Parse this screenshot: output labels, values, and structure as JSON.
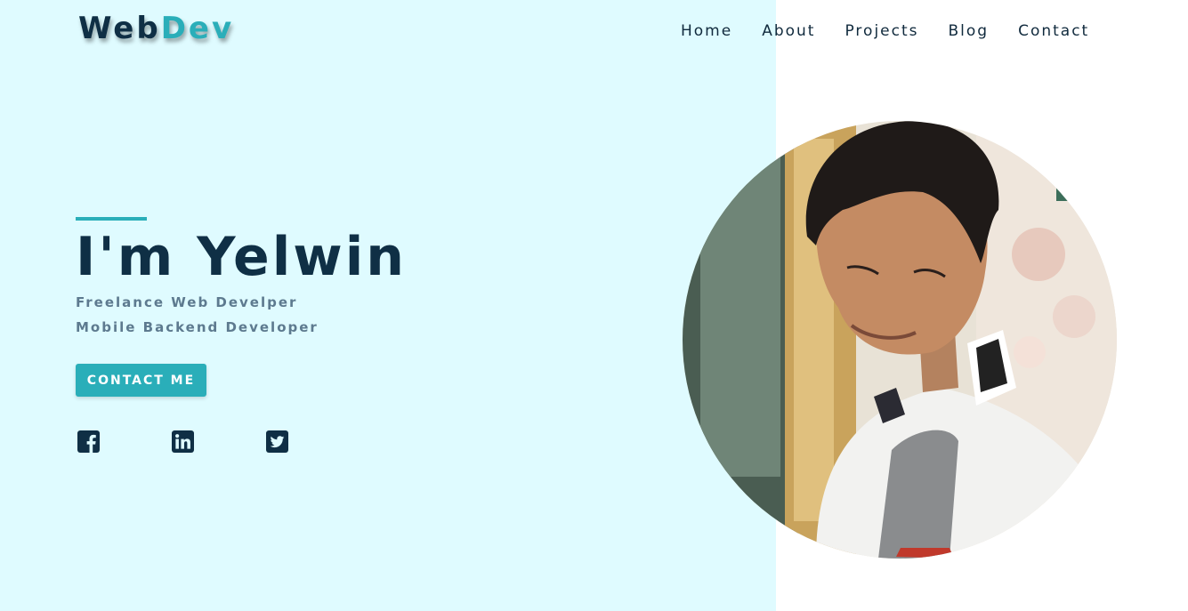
{
  "logo": {
    "part1": "Web",
    "part2": "Dev"
  },
  "nav": {
    "items": [
      {
        "label": "Home"
      },
      {
        "label": "About"
      },
      {
        "label": "Projects"
      },
      {
        "label": "Blog"
      },
      {
        "label": "Contact"
      }
    ]
  },
  "hero": {
    "title": "I'm Yelwin",
    "subtitle_1": "Freelance Web Develper",
    "subtitle_2": "Mobile Backend Developer",
    "cta_label": "CONTACT ME"
  },
  "social": [
    {
      "icon": "facebook-icon"
    },
    {
      "icon": "linkedin-icon"
    },
    {
      "icon": "twitter-icon"
    }
  ],
  "colors": {
    "left_background": "#dffbff",
    "primary_dark": "#0f2f45",
    "accent": "#2aaeb9",
    "subtitle": "#5d7a8f"
  }
}
